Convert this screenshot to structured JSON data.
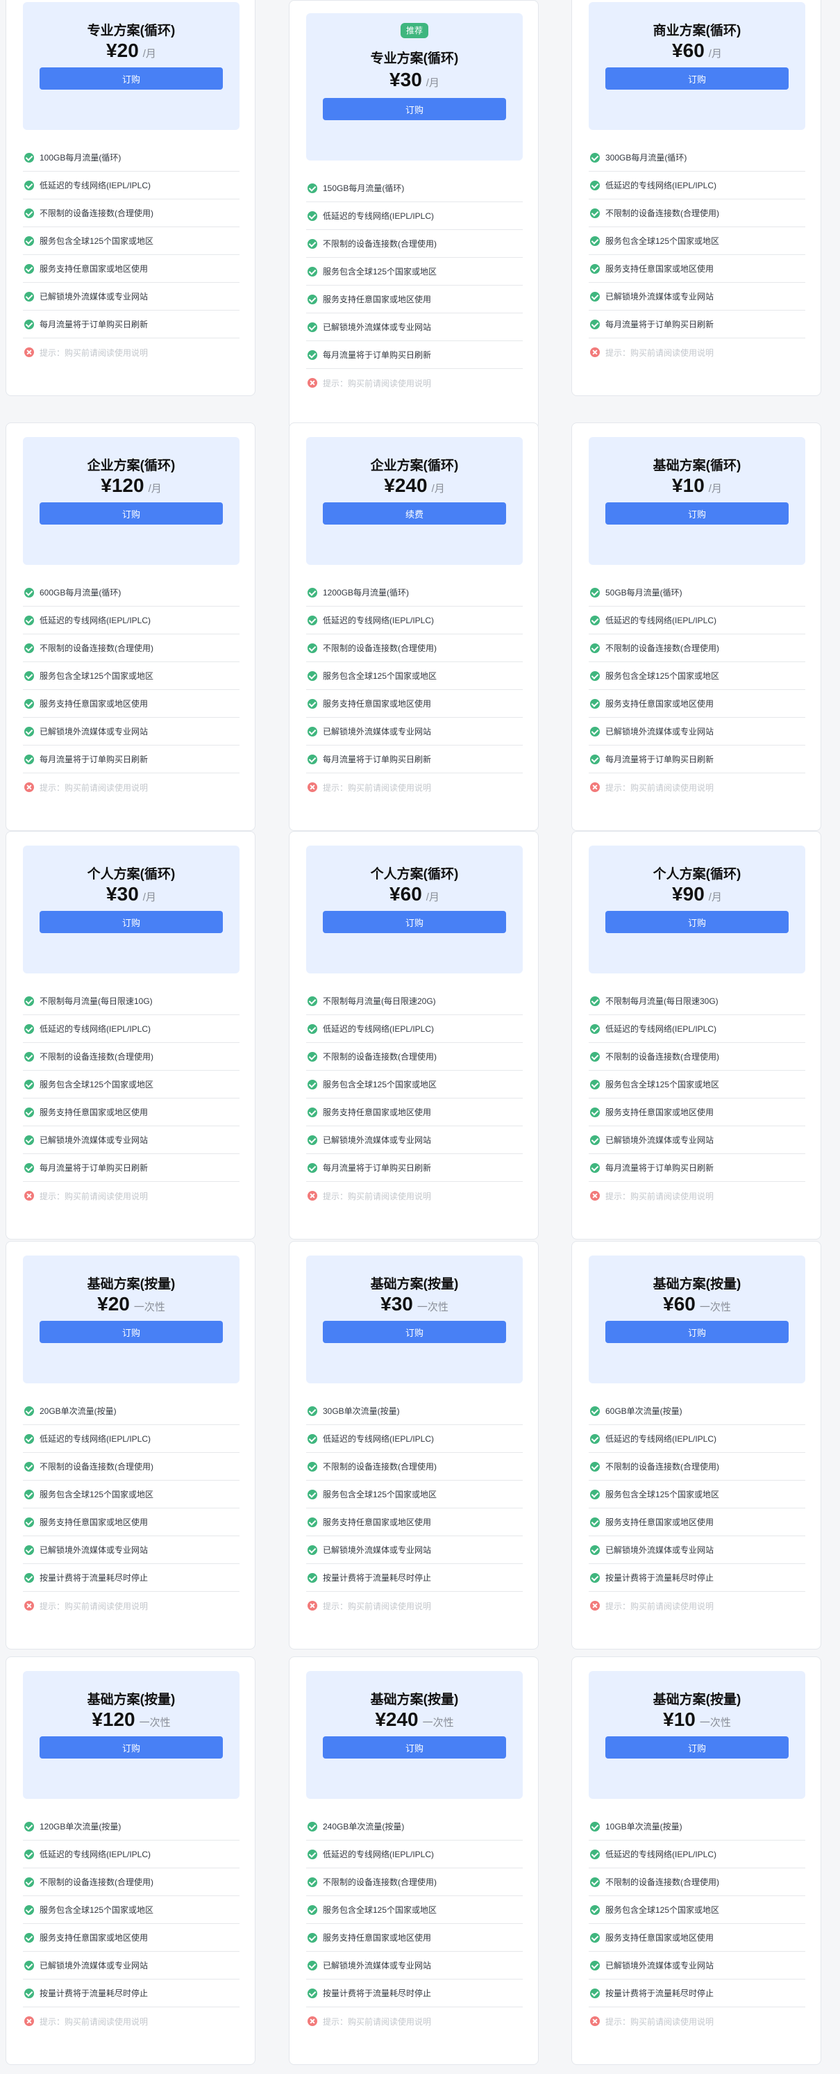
{
  "colors": {
    "accent": "#4880f5",
    "hero_bg": "#e8f0ff",
    "check": "#3fb67e",
    "cross": "#f27a7a",
    "badge": "#3fb67e"
  },
  "icons": {
    "feature_icon": "check-circle-icon",
    "tip_icon": "x-circle-icon"
  },
  "plans": [
    {
      "badge": "",
      "title": "专业方案(循环)",
      "price": "¥20",
      "unit": "/月",
      "button": "订购",
      "features": [
        "100GB每月流量(循环)",
        "低延迟的专线网络(IEPL/IPLC)",
        "不限制的设备连接数(合理使用)",
        "服务包含全球125个国家或地区",
        "服务支持任意国家或地区使用",
        "已解锁境外流媒体或专业网站",
        "每月流量将于订单购买日刷新"
      ],
      "tip": "提示：购买前请阅读使用说明"
    },
    {
      "badge": "推荐",
      "title": "专业方案(循环)",
      "price": "¥30",
      "unit": "/月",
      "button": "订购",
      "features": [
        "150GB每月流量(循环)",
        "低延迟的专线网络(IEPL/IPLC)",
        "不限制的设备连接数(合理使用)",
        "服务包含全球125个国家或地区",
        "服务支持任意国家或地区使用",
        "已解锁境外流媒体或专业网站",
        "每月流量将于订单购买日刷新"
      ],
      "tip": "提示：购买前请阅读使用说明"
    },
    {
      "badge": "",
      "title": "商业方案(循环)",
      "price": "¥60",
      "unit": "/月",
      "button": "订购",
      "features": [
        "300GB每月流量(循环)",
        "低延迟的专线网络(IEPL/IPLC)",
        "不限制的设备连接数(合理使用)",
        "服务包含全球125个国家或地区",
        "服务支持任意国家或地区使用",
        "已解锁境外流媒体或专业网站",
        "每月流量将于订单购买日刷新"
      ],
      "tip": "提示：购买前请阅读使用说明"
    },
    {
      "badge": "",
      "title": "企业方案(循环)",
      "price": "¥120",
      "unit": "/月",
      "button": "订购",
      "features": [
        "600GB每月流量(循环)",
        "低延迟的专线网络(IEPL/IPLC)",
        "不限制的设备连接数(合理使用)",
        "服务包含全球125个国家或地区",
        "服务支持任意国家或地区使用",
        "已解锁境外流媒体或专业网站",
        "每月流量将于订单购买日刷新"
      ],
      "tip": "提示：购买前请阅读使用说明"
    },
    {
      "badge": "",
      "title": "企业方案(循环)",
      "price": "¥240",
      "unit": "/月",
      "button": "续费",
      "features": [
        "1200GB每月流量(循环)",
        "低延迟的专线网络(IEPL/IPLC)",
        "不限制的设备连接数(合理使用)",
        "服务包含全球125个国家或地区",
        "服务支持任意国家或地区使用",
        "已解锁境外流媒体或专业网站",
        "每月流量将于订单购买日刷新"
      ],
      "tip": "提示：购买前请阅读使用说明"
    },
    {
      "badge": "",
      "title": "基础方案(循环)",
      "price": "¥10",
      "unit": "/月",
      "button": "订购",
      "features": [
        "50GB每月流量(循环)",
        "低延迟的专线网络(IEPL/IPLC)",
        "不限制的设备连接数(合理使用)",
        "服务包含全球125个国家或地区",
        "服务支持任意国家或地区使用",
        "已解锁境外流媒体或专业网站",
        "每月流量将于订单购买日刷新"
      ],
      "tip": "提示：购买前请阅读使用说明"
    },
    {
      "badge": "",
      "title": "个人方案(循环)",
      "price": "¥30",
      "unit": "/月",
      "button": "订购",
      "features": [
        "不限制每月流量(每日限速10G)",
        "低延迟的专线网络(IEPL/IPLC)",
        "不限制的设备连接数(合理使用)",
        "服务包含全球125个国家或地区",
        "服务支持任意国家或地区使用",
        "已解锁境外流媒体或专业网站",
        "每月流量将于订单购买日刷新"
      ],
      "tip": "提示：购买前请阅读使用说明"
    },
    {
      "badge": "",
      "title": "个人方案(循环)",
      "price": "¥60",
      "unit": "/月",
      "button": "订购",
      "features": [
        "不限制每月流量(每日限速20G)",
        "低延迟的专线网络(IEPL/IPLC)",
        "不限制的设备连接数(合理使用)",
        "服务包含全球125个国家或地区",
        "服务支持任意国家或地区使用",
        "已解锁境外流媒体或专业网站",
        "每月流量将于订单购买日刷新"
      ],
      "tip": "提示：购买前请阅读使用说明"
    },
    {
      "badge": "",
      "title": "个人方案(循环)",
      "price": "¥90",
      "unit": "/月",
      "button": "订购",
      "features": [
        "不限制每月流量(每日限速30G)",
        "低延迟的专线网络(IEPL/IPLC)",
        "不限制的设备连接数(合理使用)",
        "服务包含全球125个国家或地区",
        "服务支持任意国家或地区使用",
        "已解锁境外流媒体或专业网站",
        "每月流量将于订单购买日刷新"
      ],
      "tip": "提示：购买前请阅读使用说明"
    },
    {
      "badge": "",
      "title": "基础方案(按量)",
      "price": "¥20",
      "unit": "一次性",
      "button": "订购",
      "features": [
        "20GB单次流量(按量)",
        "低延迟的专线网络(IEPL/IPLC)",
        "不限制的设备连接数(合理使用)",
        "服务包含全球125个国家或地区",
        "服务支持任意国家或地区使用",
        "已解锁境外流媒体或专业网站",
        "按量计费将于流量耗尽时停止"
      ],
      "tip": "提示：购买前请阅读使用说明"
    },
    {
      "badge": "",
      "title": "基础方案(按量)",
      "price": "¥30",
      "unit": "一次性",
      "button": "订购",
      "features": [
        "30GB单次流量(按量)",
        "低延迟的专线网络(IEPL/IPLC)",
        "不限制的设备连接数(合理使用)",
        "服务包含全球125个国家或地区",
        "服务支持任意国家或地区使用",
        "已解锁境外流媒体或专业网站",
        "按量计费将于流量耗尽时停止"
      ],
      "tip": "提示：购买前请阅读使用说明"
    },
    {
      "badge": "",
      "title": "基础方案(按量)",
      "price": "¥60",
      "unit": "一次性",
      "button": "订购",
      "features": [
        "60GB单次流量(按量)",
        "低延迟的专线网络(IEPL/IPLC)",
        "不限制的设备连接数(合理使用)",
        "服务包含全球125个国家或地区",
        "服务支持任意国家或地区使用",
        "已解锁境外流媒体或专业网站",
        "按量计费将于流量耗尽时停止"
      ],
      "tip": "提示：购买前请阅读使用说明"
    },
    {
      "badge": "",
      "title": "基础方案(按量)",
      "price": "¥120",
      "unit": "一次性",
      "button": "订购",
      "features": [
        "120GB单次流量(按量)",
        "低延迟的专线网络(IEPL/IPLC)",
        "不限制的设备连接数(合理使用)",
        "服务包含全球125个国家或地区",
        "服务支持任意国家或地区使用",
        "已解锁境外流媒体或专业网站",
        "按量计费将于流量耗尽时停止"
      ],
      "tip": "提示：购买前请阅读使用说明"
    },
    {
      "badge": "",
      "title": "基础方案(按量)",
      "price": "¥240",
      "unit": "一次性",
      "button": "订购",
      "features": [
        "240GB单次流量(按量)",
        "低延迟的专线网络(IEPL/IPLC)",
        "不限制的设备连接数(合理使用)",
        "服务包含全球125个国家或地区",
        "服务支持任意国家或地区使用",
        "已解锁境外流媒体或专业网站",
        "按量计费将于流量耗尽时停止"
      ],
      "tip": "提示：购买前请阅读使用说明"
    },
    {
      "badge": "",
      "title": "基础方案(按量)",
      "price": "¥10",
      "unit": "一次性",
      "button": "订购",
      "features": [
        "10GB单次流量(按量)",
        "低延迟的专线网络(IEPL/IPLC)",
        "不限制的设备连接数(合理使用)",
        "服务包含全球125个国家或地区",
        "服务支持任意国家或地区使用",
        "已解锁境外流媒体或专业网站",
        "按量计费将于流量耗尽时停止"
      ],
      "tip": "提示：购买前请阅读使用说明"
    }
  ]
}
